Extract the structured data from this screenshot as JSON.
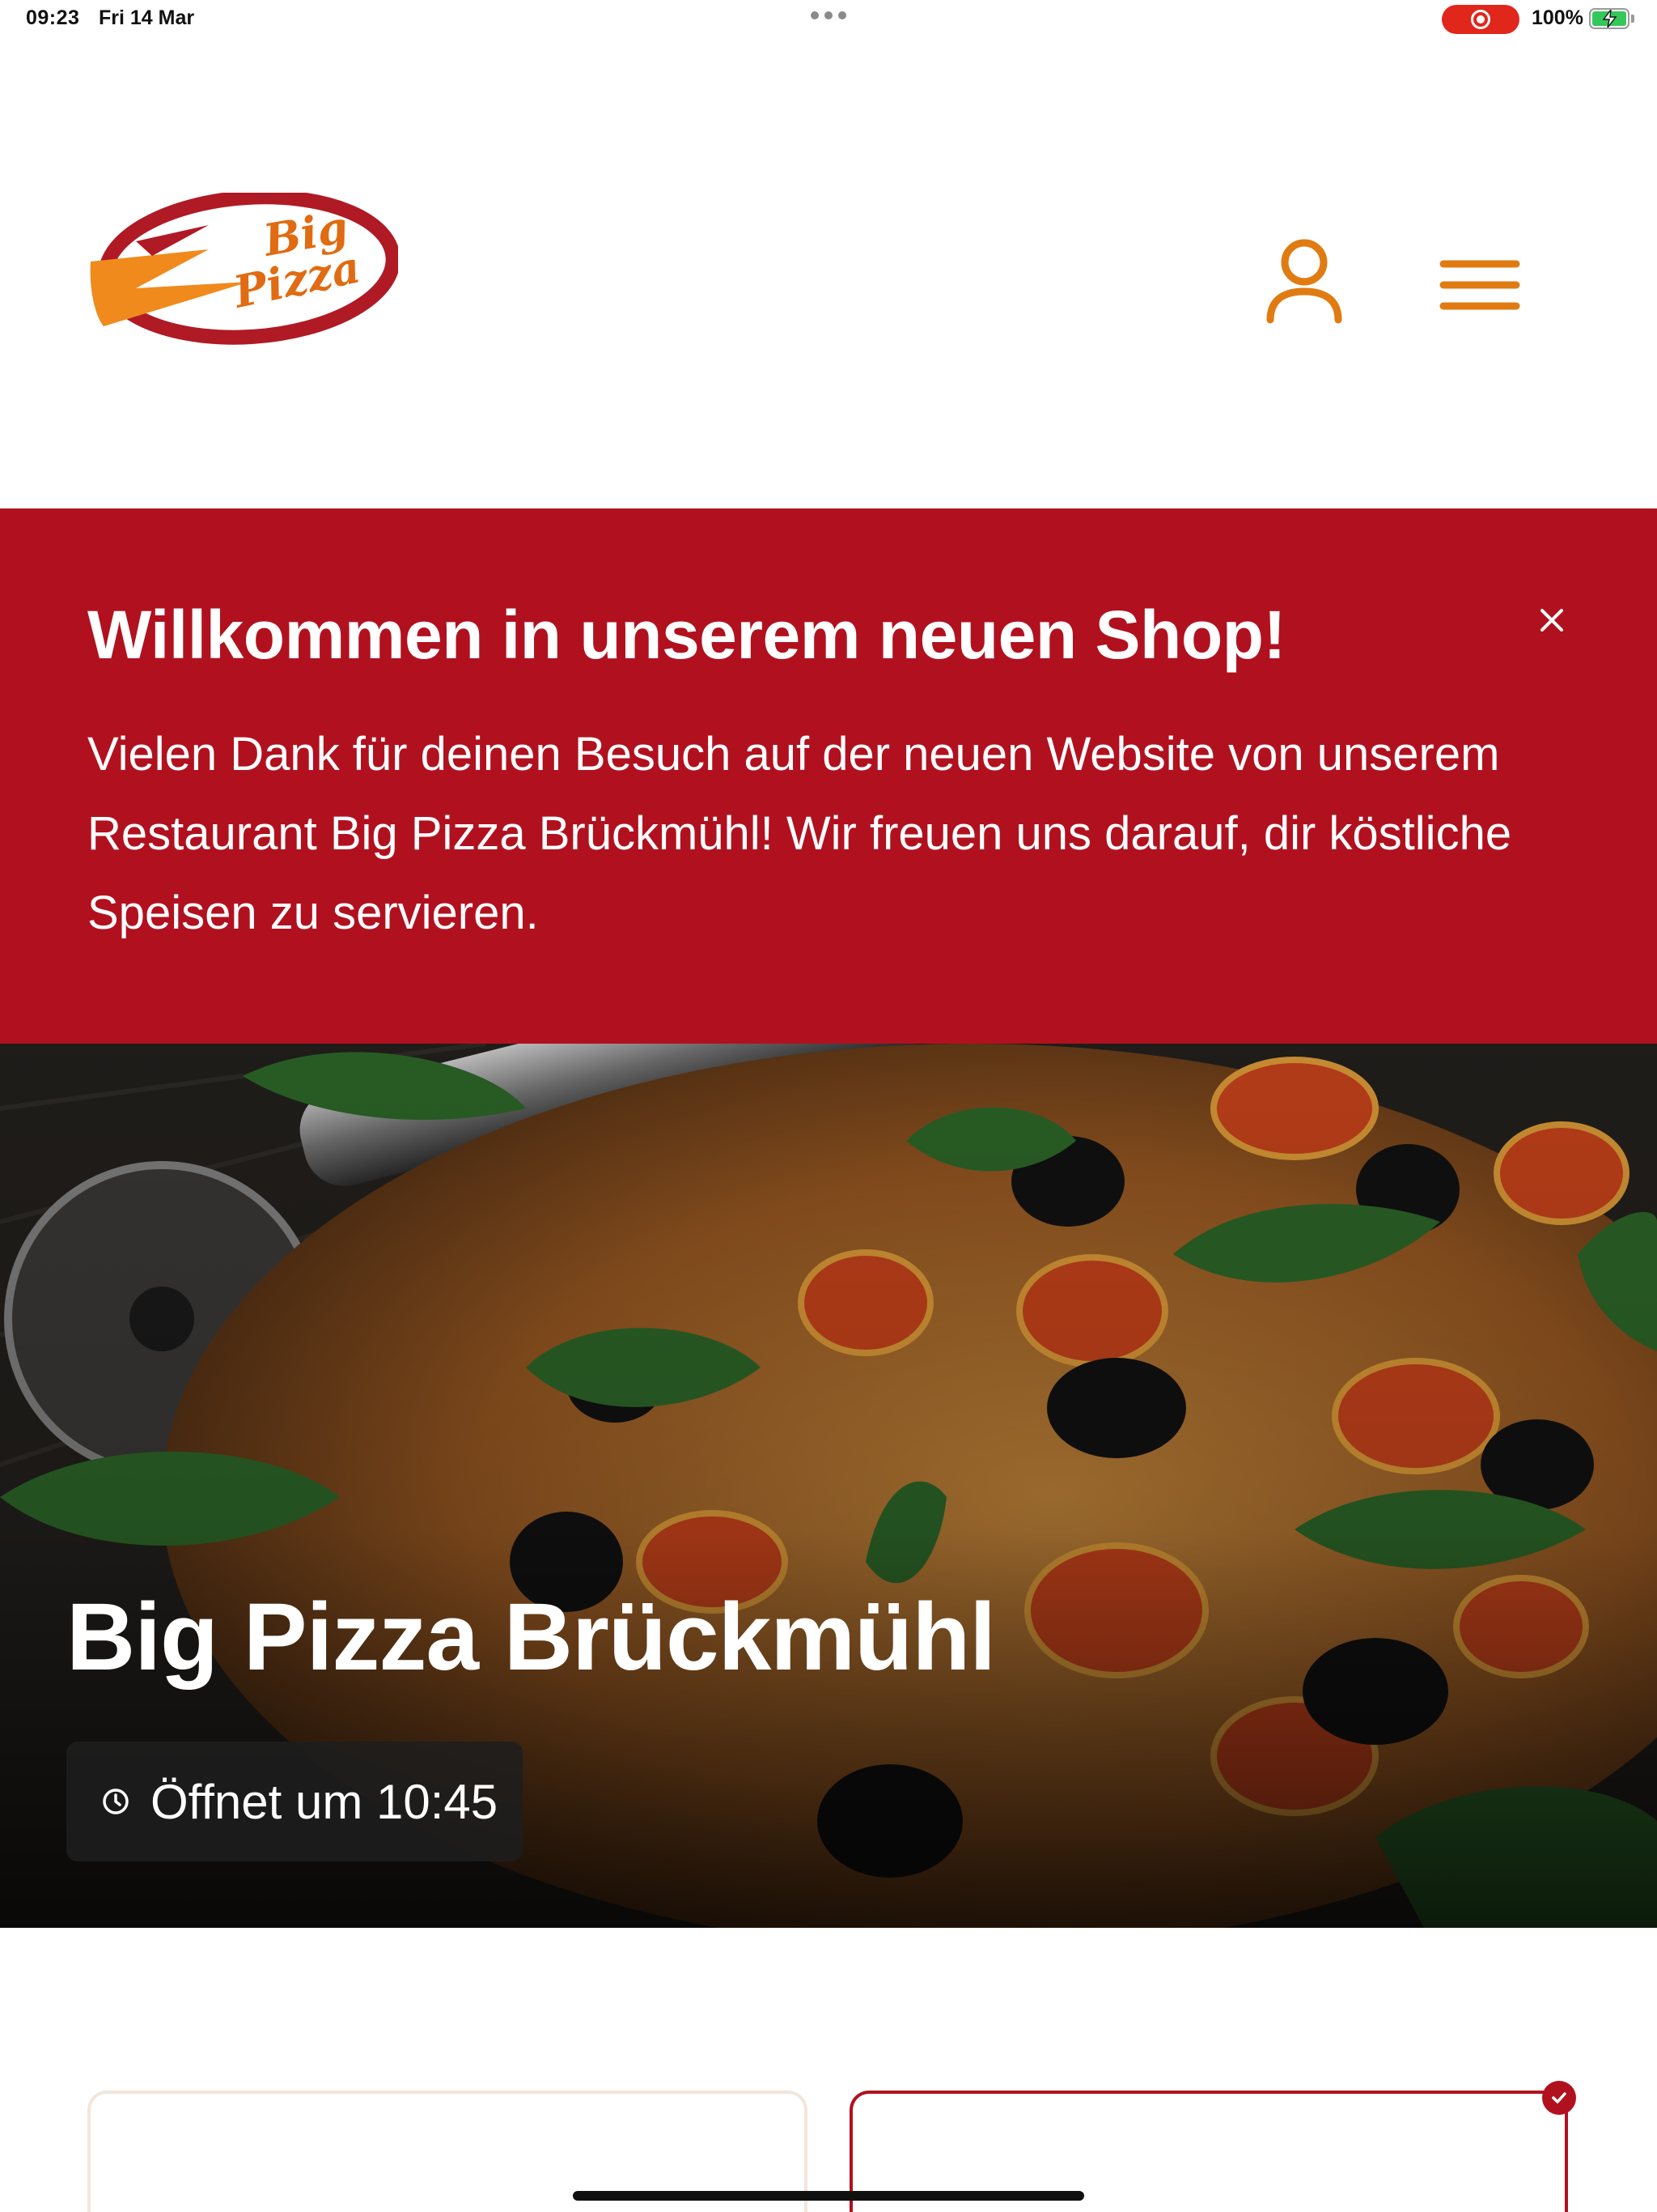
{
  "status_bar": {
    "time": "09:23",
    "date": "Fri 14 Mar",
    "battery": "100%"
  },
  "header": {
    "logo_text_line1": "Big",
    "logo_text_line2": "Pizza",
    "account_icon": "user-icon",
    "menu_icon": "hamburger-menu-icon",
    "accent_color": "#e07b12"
  },
  "banner": {
    "title": "Willkommen in unserem neuen Shop!",
    "text": "Vielen Dank für deinen Besuch auf der neuen Website von unserem Restaurant Big Pizza Brückmühl! Wir freuen uns darauf, dir köstliche Speisen zu servieren.",
    "close_icon": "close-icon",
    "background_color": "#b1111f"
  },
  "hero": {
    "title": "Big Pizza Brückmühl",
    "hours_icon": "clock-icon",
    "hours_text": "Öffnet um 10:45"
  },
  "cards": {
    "selected_icon": "checkmark-icon"
  }
}
